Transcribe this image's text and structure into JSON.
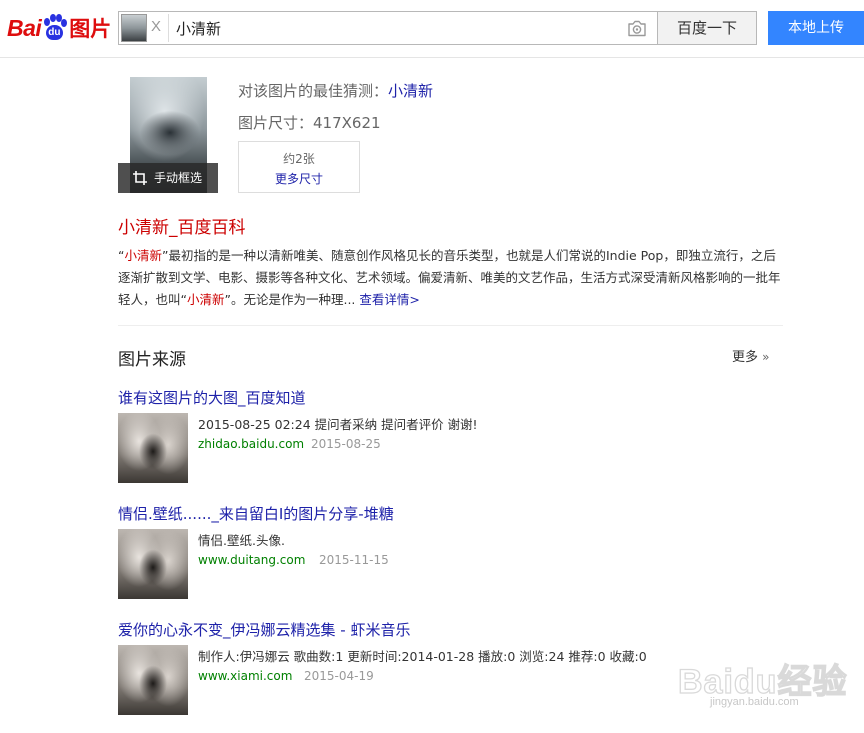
{
  "header": {
    "logo_bai": "Bai",
    "logo_du": "du",
    "logo_img": "图片",
    "search_clear": "X",
    "search_value": "小清新",
    "search_button": "百度一下",
    "upload_button": "本地上传"
  },
  "guess": {
    "crop_label": "手动框选",
    "best_guess_prefix": "对该图片的最佳猜测：",
    "best_guess_value": "小清新",
    "size_label": "图片尺寸：417X621",
    "size_count": "约2张",
    "size_more": "更多尺寸"
  },
  "baike": {
    "title": "小清新_百度百科",
    "q_open": "“",
    "term1": "小清新",
    "text1": "”最初指的是一种以清新唯美、随意创作风格见长的音乐类型，也就是人们常说的Indie Pop，即独立流行，之后逐渐扩散到文学、电影、摄影等各种文化、艺术领域。偏爱清新、唯美的文艺作品，生活方式深受清新风格影响的一批年轻人，也叫“",
    "term2": "小清新",
    "text2": "”。无论是作为一种理... ",
    "more": "查看详情>"
  },
  "sources": {
    "heading": "图片来源",
    "more": "更多",
    "more_chevron": "»",
    "items": [
      {
        "title": "谁有这图片的大图_百度知道",
        "desc": "2015-08-25 02:24 提问者采纳 提问者评价 谢谢!",
        "site": "zhidao.baidu.com",
        "date": "2015-08-25"
      },
      {
        "title": "情侣.壁纸......_来自留白I的图片分享-堆糖",
        "desc": "情侣.壁纸.头像.",
        "site": "www.duitang.com",
        "date": "2015-11-15"
      },
      {
        "title": "爱你的心永不变_伊冯娜云精选集 - 虾米音乐",
        "desc": "制作人:伊冯娜云 歌曲数:1  更新时间:2014-01-28 播放:0  浏览:24  推荐:0  收藏:0",
        "site": "www.xiami.com",
        "date": "2015-04-19"
      }
    ]
  },
  "watermark": {
    "text": "Baidu经验",
    "sub": "jingyan.baidu.com"
  }
}
